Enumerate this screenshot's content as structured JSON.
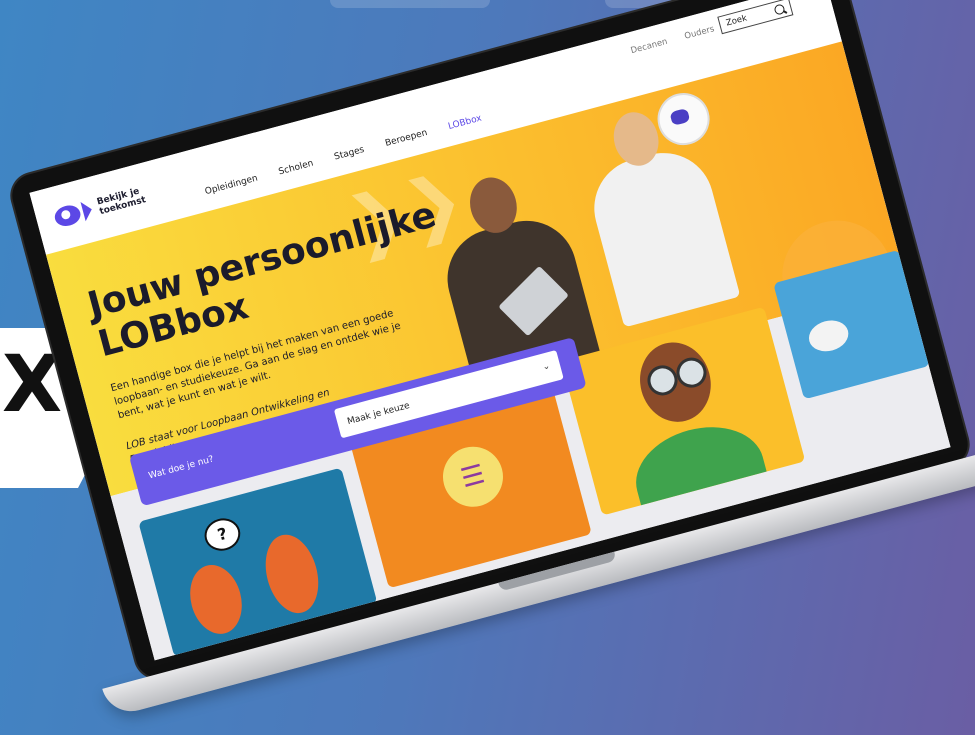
{
  "badge_text": "X",
  "nav": {
    "logo_line1": "Bekijk je",
    "logo_line2": "toekomst",
    "items": [
      "Opleidingen",
      "Scholen",
      "Stages",
      "Beroepen",
      "LOBbox"
    ],
    "secondary": [
      "Decanen",
      "Ouders"
    ],
    "search_placeholder": "Zoek"
  },
  "hero": {
    "title": "Jouw persoonlijke LOBbox",
    "description": "Een handige box die je helpt bij het maken van een goede loopbaan- en studiekeuze. Ga aan de slag en ontdek wie je bent, wat je kunt en wat je wilt.",
    "note": "LOB staat voor Loopbaan Ontwikkeling en Begeleiding"
  },
  "choice": {
    "label": "Wat doe je nu?",
    "select_value": "Maak je keuze"
  },
  "colors": {
    "accent": "#5c48e6",
    "hero_yellow": "#f9dd3e",
    "hero_orange": "#fba824",
    "panel_purple": "#6b5ae8"
  },
  "icons": {
    "search": "search-icon",
    "select_chevron": "chevron-down-icon"
  }
}
